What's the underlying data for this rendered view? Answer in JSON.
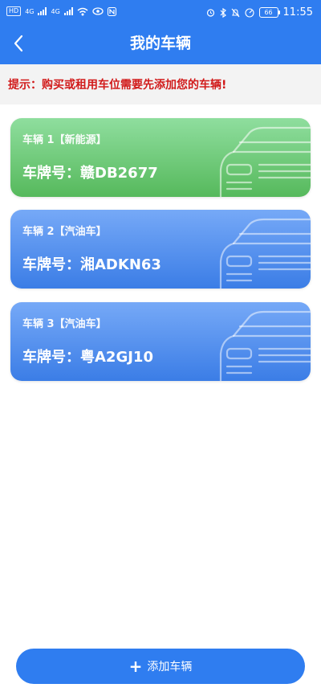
{
  "status_bar": {
    "left_chip": "HD",
    "net_a": "4G",
    "net_b": "4G",
    "time": "11:55",
    "battery": "66"
  },
  "header": {
    "back_icon": "chevron-left",
    "title": "我的车辆"
  },
  "notice": {
    "text": "提示：购买或租用车位需要先添加您的车辆!"
  },
  "vehicles": [
    {
      "label": "车辆 1【新能源】",
      "plate": "车牌号：赣DB2677",
      "color": "#5cbd63"
    },
    {
      "label": "车辆 2【汽油车】",
      "plate": "车牌号：湘ADKN63",
      "color": "#4a88ea"
    },
    {
      "label": "车辆 3【汽油车】",
      "plate": "车牌号：粤A2GJ10",
      "color": "#4a88ea"
    }
  ],
  "footer": {
    "add_icon": "plus",
    "add_label": "添加车辆"
  },
  "colors": {
    "primary": "#2f7df0",
    "notice_text": "#d11a1a",
    "green_card": "#5cbd63",
    "blue_card": "#4a88ea"
  }
}
